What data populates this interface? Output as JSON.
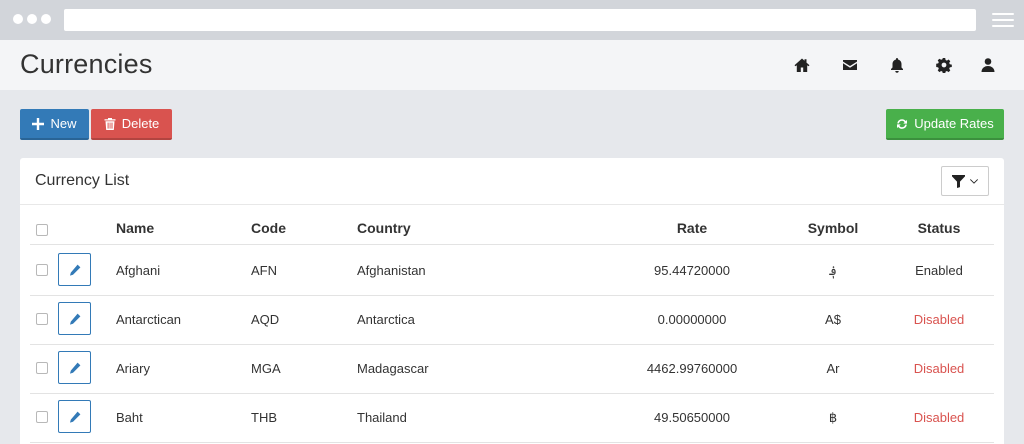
{
  "page": {
    "title": "Currencies"
  },
  "header_icons": [
    "home-icon",
    "envelope-icon",
    "bell-icon",
    "gear-icon",
    "user-icon"
  ],
  "toolbar": {
    "new_label": "New",
    "delete_label": "Delete",
    "update_label": "Update Rates"
  },
  "panel": {
    "title": "Currency List"
  },
  "table": {
    "columns": {
      "name": "Name",
      "code": "Code",
      "country": "Country",
      "rate": "Rate",
      "symbol": "Symbol",
      "status": "Status"
    },
    "rows": [
      {
        "name": "Afghani",
        "code": "AFN",
        "country": "Afghanistan",
        "rate": "95.44720000",
        "symbol": "؋",
        "status": "Enabled"
      },
      {
        "name": "Antarctican",
        "code": "AQD",
        "country": "Antarctica",
        "rate": "0.00000000",
        "symbol": "A$",
        "status": "Disabled"
      },
      {
        "name": "Ariary",
        "code": "MGA",
        "country": "Madagascar",
        "rate": "4462.99760000",
        "symbol": "Ar",
        "status": "Disabled"
      },
      {
        "name": "Baht",
        "code": "THB",
        "country": "Thailand",
        "rate": "49.50650000",
        "symbol": "฿",
        "status": "Disabled"
      }
    ]
  },
  "colors": {
    "primary": "#337ab7",
    "danger": "#d9534f",
    "success": "#49b04b",
    "disabled_text": "#d9534f"
  }
}
